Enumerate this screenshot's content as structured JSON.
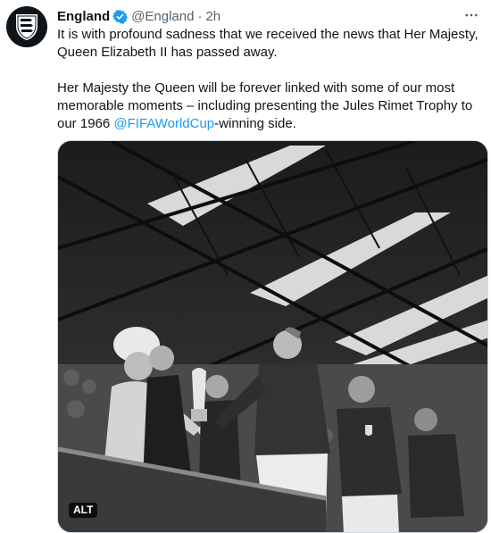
{
  "tweet": {
    "author_name": "England",
    "author_handle": "@England",
    "separator": "·",
    "timestamp": "2h",
    "more_icon": "ellipsis-icon",
    "avatar_icon": "three-lions-crest-icon",
    "verified_icon": "verified-badge-icon",
    "paragraph_1": "It is with profound sadness that we received the news that Her Majesty, Queen Elizabeth II has passed away.",
    "paragraph_2_before": "Her Majesty the Queen will be forever linked with some of our most memorable moments – including presenting the Jules Rimet Trophy to our 1966 ",
    "paragraph_2_mention": "@FIFAWorldCup",
    "paragraph_2_after": "-winning side.",
    "media_alt_badge": "ALT"
  },
  "colors": {
    "text": "#0f1419",
    "secondary": "#536471",
    "link": "#1d9bf0",
    "verified": "#1d9bf0"
  }
}
